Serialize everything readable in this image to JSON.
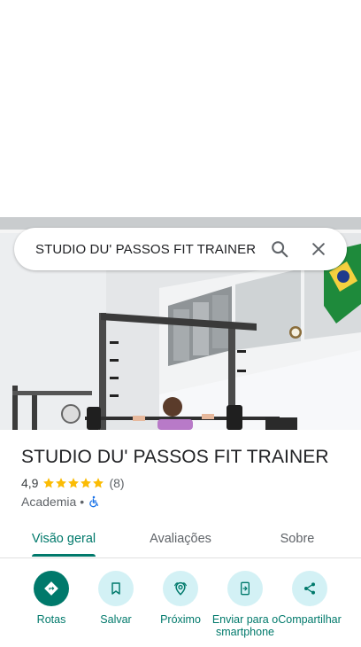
{
  "search": {
    "query": "STUDIO DU' PASSOS FIT TRAINER",
    "search_icon": "search-icon",
    "close_icon": "close-icon"
  },
  "place": {
    "name": "STUDIO DU' PASSOS FIT TRAINER",
    "rating": "4,9",
    "stars": 5,
    "review_count": "(8)",
    "category": "Academia",
    "separator": "•",
    "accessibility_icon": "wheelchair-icon"
  },
  "tabs": [
    {
      "label": "Visão geral",
      "selected": true
    },
    {
      "label": "Avaliações",
      "selected": false
    },
    {
      "label": "Sobre",
      "selected": false
    }
  ],
  "actions": [
    {
      "label": "Rotas",
      "icon": "directions-icon"
    },
    {
      "label": "Salvar",
      "icon": "bookmark-icon"
    },
    {
      "label": "Próximo",
      "icon": "nearby-icon"
    },
    {
      "label": "Enviar para o smartphone",
      "icon": "send-to-phone-icon"
    },
    {
      "label": "Compartilhar",
      "icon": "share-icon"
    }
  ],
  "colors": {
    "accent": "#00796b",
    "action_bg": "#d3f1f5",
    "star": "#fbbc04",
    "accessibility": "#1a73e8"
  }
}
